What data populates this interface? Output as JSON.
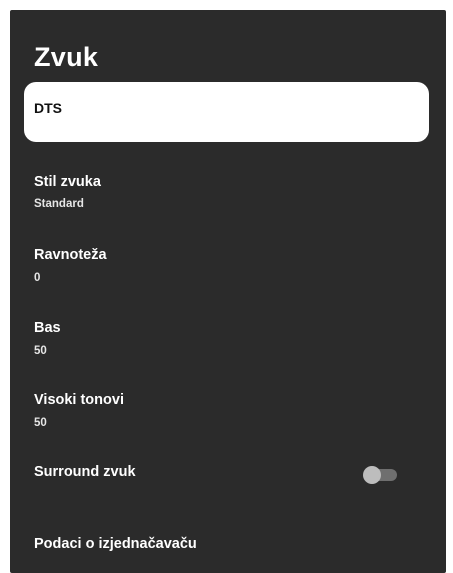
{
  "page": {
    "title": "Zvuk"
  },
  "items": [
    {
      "label": "DTS",
      "value": ""
    },
    {
      "label": "Stil zvuka",
      "value": "Standard"
    },
    {
      "label": "Ravnoteža",
      "value": "0"
    },
    {
      "label": "Bas",
      "value": "50"
    },
    {
      "label": "Visoki tonovi",
      "value": "50"
    },
    {
      "label": "Surround zvuk",
      "value": "",
      "toggle": "off"
    },
    {
      "label": "Podaci o izjednačavaču",
      "value": ""
    }
  ],
  "colors": {
    "background": "#2b2b2b",
    "focus": "#ffffff",
    "toggle_track": "#6f6f6f",
    "toggle_thumb": "#bdbdbd"
  }
}
